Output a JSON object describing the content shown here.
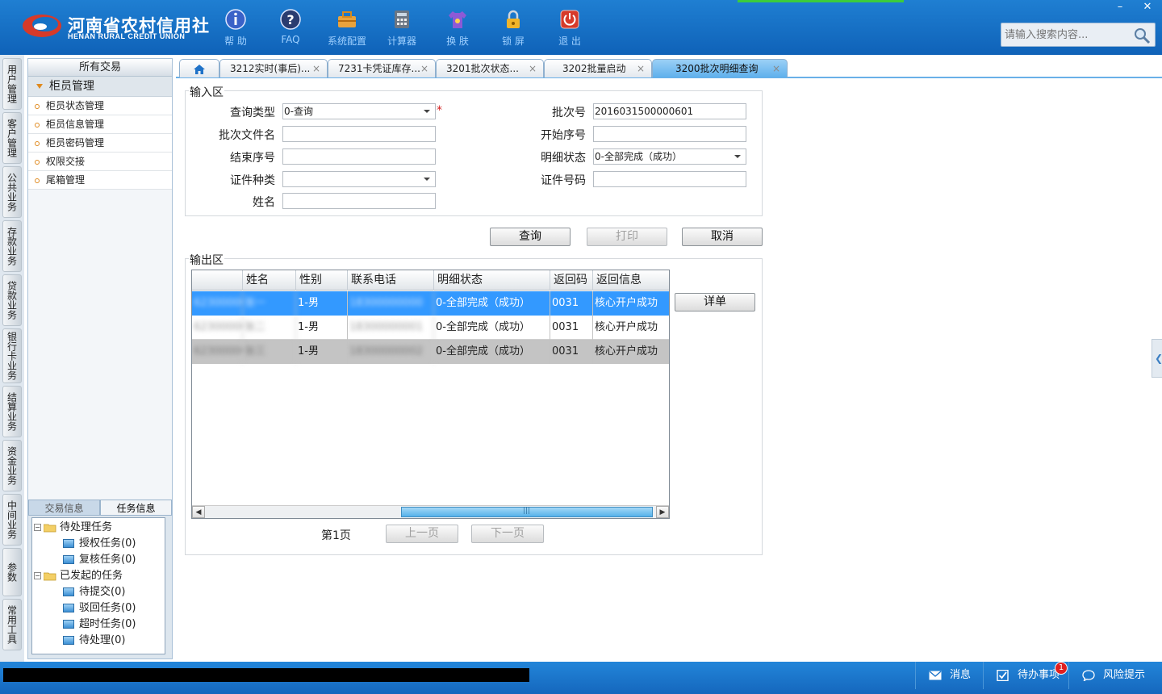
{
  "header": {
    "logo_cn": "河南省农村信用社",
    "logo_en": "HENAN RURAL CREDIT UNION",
    "tools": [
      {
        "label": "帮 助",
        "icon": "info-icon"
      },
      {
        "label": "FAQ",
        "icon": "question-icon"
      },
      {
        "label": "系统配置",
        "icon": "toolbox-icon"
      },
      {
        "label": "计算器",
        "icon": "calculator-icon"
      },
      {
        "label": "换 肤",
        "icon": "shirt-icon"
      },
      {
        "label": "锁 屏",
        "icon": "lock-icon"
      },
      {
        "label": "退 出",
        "icon": "power-icon"
      }
    ],
    "minimize": "–",
    "close": "✕",
    "search_placeholder": "请输入搜索内容..."
  },
  "vtabs": [
    "用户管理",
    "客户管理",
    "公共业务",
    "存款业务",
    "贷款业务",
    "银行卡业务",
    "结算业务",
    "资金业务",
    "中间业务",
    "参数",
    "常用工具"
  ],
  "sidebar": {
    "title": "所有交易",
    "group": "柜员管理",
    "items": [
      "柜员状态管理",
      "柜员信息管理",
      "柜员密码管理",
      "权限交接",
      "尾箱管理"
    ],
    "bottom_tabs": [
      "交易信息",
      "任务信息"
    ],
    "tree": {
      "pending": "待处理任务",
      "pending_children": [
        "授权任务(0)",
        "复核任务(0)"
      ],
      "initiated": "已发起的任务",
      "initiated_children": [
        "待提交(0)",
        "驳回任务(0)",
        "超时任务(0)",
        "待处理(0)"
      ]
    }
  },
  "tabs": [
    {
      "label": "3212实时(事后)..."
    },
    {
      "label": "7231卡凭证库存..."
    },
    {
      "label": "3201批次状态..."
    },
    {
      "label": "3202批量启动"
    },
    {
      "label": "3200批次明细查询"
    }
  ],
  "form": {
    "input_title": "输入区",
    "query_type_label": "查询类型",
    "query_type_value": "0-查询",
    "batch_no_label": "批次号",
    "batch_no_value": "2016031500000601",
    "batch_file_label": "批次文件名",
    "batch_file_value": "",
    "start_seq_label": "开始序号",
    "start_seq_value": "",
    "end_seq_label": "结束序号",
    "end_seq_value": "",
    "detail_status_label": "明细状态",
    "detail_status_value": "0-全部完成（成功）",
    "id_type_label": "证件种类",
    "id_type_value": "",
    "id_no_label": "证件号码",
    "id_no_value": "",
    "name_label": "姓名",
    "name_value": "",
    "required_mark": "*"
  },
  "buttons": {
    "query": "查询",
    "print": "打印",
    "cancel": "取消",
    "detail": "详单",
    "prev": "上一页",
    "next": "下一页"
  },
  "output": {
    "title": "输出区",
    "columns": [
      "",
      "姓名",
      "性别",
      "联系电话",
      "明细状态",
      "返回码",
      "返回信息"
    ],
    "rows": [
      {
        "acct": "6230000000",
        "name": "张一",
        "gender": "1-男",
        "phone": "18300000000",
        "status": "0-全部完成（成功）",
        "code": "0031",
        "msg": "核心开户成功"
      },
      {
        "acct": "6230000001",
        "name": "张二",
        "gender": "1-男",
        "phone": "18300000001",
        "status": "0-全部完成（成功）",
        "code": "0031",
        "msg": "核心开户成功"
      },
      {
        "acct": "6230000002",
        "name": "张三",
        "gender": "1-男",
        "phone": "18300000002",
        "status": "0-全部完成（成功）",
        "code": "0031",
        "msg": "核心开户成功"
      }
    ],
    "page_label": "第1页"
  },
  "statusbar": {
    "message": "消息",
    "todo": "待办事项",
    "todo_count": "1",
    "risk": "风险提示"
  },
  "colors": {
    "header_blue": "#1572c6",
    "selected_row": "#3399ff",
    "status_blue": "#1a72c9"
  }
}
